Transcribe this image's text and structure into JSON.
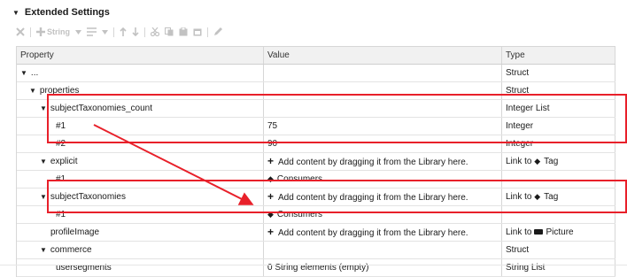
{
  "section": {
    "title": "Extended Settings"
  },
  "toolbar": {
    "string_label": "String"
  },
  "grid": {
    "columns": [
      "Property",
      "Value",
      "Type"
    ],
    "rows": [
      {
        "indent": 0,
        "expandable": true,
        "property": "...",
        "value": "",
        "value_icon": "",
        "type": "Struct",
        "type_icon": ""
      },
      {
        "indent": 1,
        "expandable": true,
        "property": "properties",
        "value": "",
        "value_icon": "",
        "type": "Struct",
        "type_icon": ""
      },
      {
        "indent": 2,
        "expandable": true,
        "property": "subjectTaxonomies_count",
        "value": "",
        "value_icon": "",
        "type": "Integer List",
        "type_icon": ""
      },
      {
        "indent": 3,
        "expandable": false,
        "property": "#1",
        "value": "75",
        "value_icon": "",
        "type": "Integer",
        "type_icon": ""
      },
      {
        "indent": 3,
        "expandable": false,
        "property": "#2",
        "value": "90",
        "value_icon": "",
        "type": "Integer",
        "type_icon": ""
      },
      {
        "indent": 2,
        "expandable": true,
        "property": "explicit",
        "value": "Add content by dragging it from the Library here.",
        "value_icon": "plus",
        "type": "Link to ",
        "type_icon": "tag",
        "type_suffix": "Tag"
      },
      {
        "indent": 3,
        "expandable": false,
        "property": "#1",
        "value": "Consumers",
        "value_icon": "tag",
        "type": "",
        "type_icon": ""
      },
      {
        "indent": 2,
        "expandable": true,
        "property": "subjectTaxonomies",
        "value": "Add content by dragging it from the Library here.",
        "value_icon": "plus",
        "type": "Link to ",
        "type_icon": "tag",
        "type_suffix": "Tag"
      },
      {
        "indent": 3,
        "expandable": false,
        "property": "#1",
        "value": "Consumers",
        "value_icon": "tag",
        "type": "",
        "type_icon": ""
      },
      {
        "indent": 2,
        "expandable": false,
        "property": "profileImage",
        "value": "Add content by dragging it from the Library here.",
        "value_icon": "plus",
        "type": "Link to",
        "type_icon": "picture",
        "type_suffix": "Picture"
      },
      {
        "indent": 2,
        "expandable": true,
        "property": "commerce",
        "value": "",
        "value_icon": "",
        "type": "Struct",
        "type_icon": ""
      },
      {
        "indent": 3,
        "expandable": false,
        "property": "usersegments",
        "value": "0 String elements (empty)",
        "value_icon": "",
        "type": "String List",
        "type_icon": ""
      }
    ]
  },
  "highlight_color": "#e8202a"
}
